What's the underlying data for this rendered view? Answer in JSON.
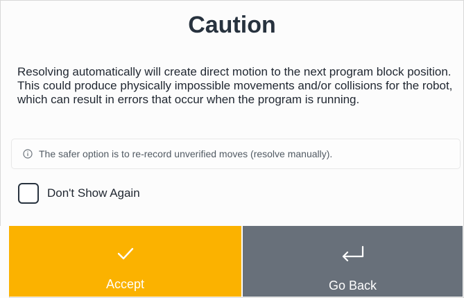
{
  "dialog": {
    "title": "Caution",
    "message": "Resolving automatically will create direct motion to the next program block position. This could produce physically impossible movements and/or collisions for the robot, which can result in errors that occur when the program is running.",
    "info": {
      "icon": "info-icon",
      "text": "The safer option is to re-record unverified moves (resolve manually)."
    },
    "dont_show_again": {
      "label": "Don't Show Again",
      "checked": false
    },
    "buttons": {
      "accept": {
        "label": "Accept",
        "icon": "checkmark-icon",
        "color": "#fbb200"
      },
      "go_back": {
        "label": "Go Back",
        "icon": "return-arrow-icon",
        "color": "#68707a"
      }
    }
  }
}
